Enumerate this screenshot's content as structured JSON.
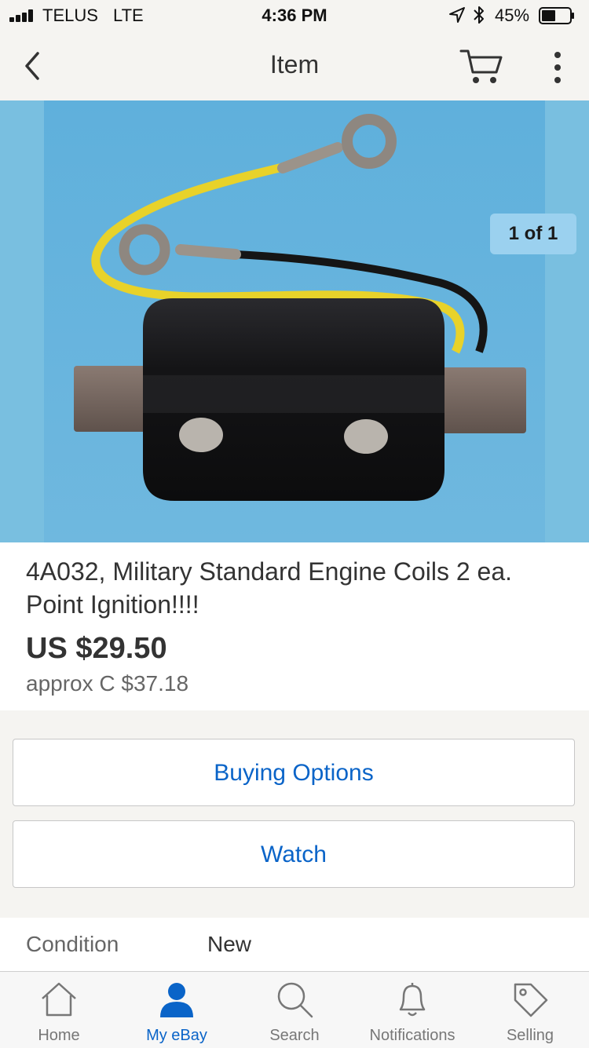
{
  "status_bar": {
    "carrier": "TELUS",
    "network": "LTE",
    "time": "4:36 PM",
    "battery_percent": "45%"
  },
  "nav": {
    "title": "Item"
  },
  "gallery": {
    "counter": "1 of 1"
  },
  "item": {
    "title": "4A032, Military Standard Engine Coils 2 ea. Point Ignition!!!!",
    "price": "US $29.50",
    "approx_price": "approx C $37.18"
  },
  "actions": {
    "buying_options": "Buying Options",
    "watch": "Watch"
  },
  "details": {
    "condition_label": "Condition",
    "condition_value": "New"
  },
  "tabs": [
    {
      "label": "Home",
      "icon": "home-icon"
    },
    {
      "label": "My eBay",
      "icon": "person-icon"
    },
    {
      "label": "Search",
      "icon": "search-icon"
    },
    {
      "label": "Notifications",
      "icon": "bell-icon"
    },
    {
      "label": "Selling",
      "icon": "tag-icon"
    }
  ],
  "colors": {
    "accent": "#0a64c8",
    "background": "#f5f4f1",
    "counter_badge": "#9bd1ef"
  }
}
